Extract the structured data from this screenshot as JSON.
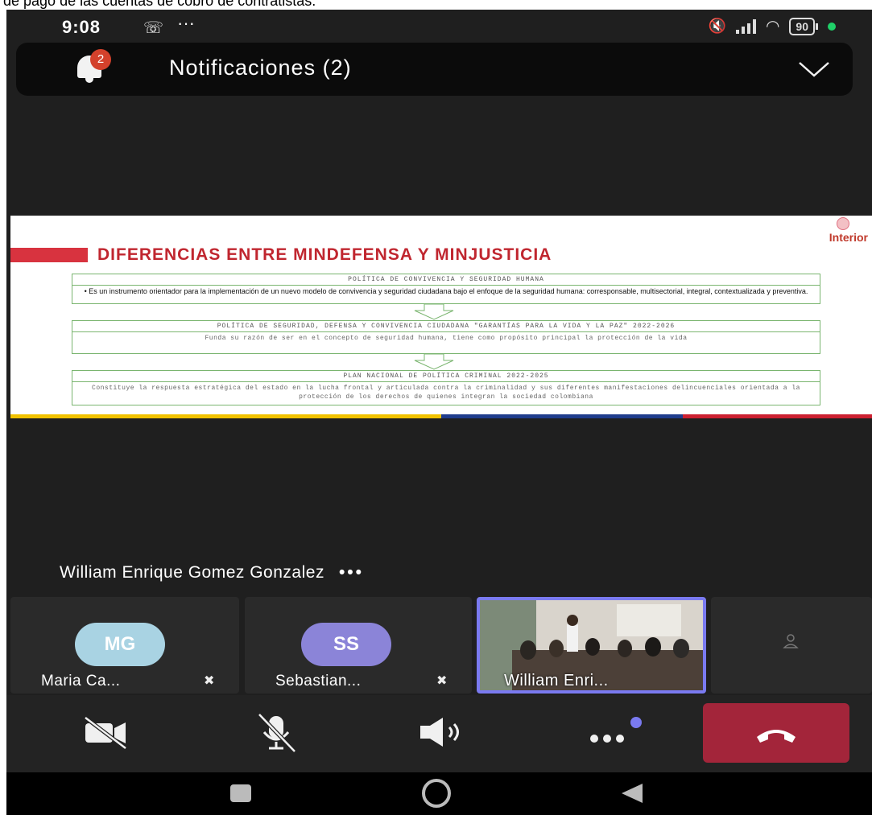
{
  "caption": "de pago de las cuentas de cobro de contratistas.",
  "status_bar": {
    "time": "9:08",
    "battery": "90"
  },
  "notifications": {
    "title": "Notificaciones (2)",
    "badge": "2"
  },
  "slide": {
    "brand": "Interior",
    "heading": "DIFERENCIAS ENTRE MINDEFENSA Y MINJUSTICIA",
    "box1_header": "POLÍTICA DE CONVIVENCIA Y SEGURIDAD HUMANA",
    "box1_body": "• Es un instrumento orientador para la implementación de un nuevo modelo de convivencia y seguridad ciudadana bajo el enfoque de la seguridad humana: corresponsable, multisectorial, integral, contextualizada y preventiva.",
    "box2_header": "POLÍTICA DE SEGURIDAD, DEFENSA Y CONVIVENCIA CIUDADANA \"GARANTÍAS PARA LA VIDA Y LA PAZ\" 2022-2026",
    "box2_body": "Funda su razón de ser en el concepto de seguridad humana, tiene como propósito principal la protección de la vida",
    "box3_header": "PLAN NACIONAL DE POLÍTICA CRIMINAL 2022-2025",
    "box3_body": "Constituye la respuesta estratégica del estado en la lucha frontal y articulada contra la criminalidad y sus diferentes manifestaciones delincuenciales orientada a la protección de los derechos de quienes integran la sociedad colombiana"
  },
  "speaker": {
    "name": "William Enrique Gomez Gonzalez"
  },
  "participants": [
    {
      "initials": "MG",
      "name": "Maria Ca...",
      "color": "#a9d3e3"
    },
    {
      "initials": "SS",
      "name": "Sebastian...",
      "color": "#8b84d8"
    },
    {
      "name": "William Enri..."
    }
  ],
  "colors": {
    "accent": "#7a7af0",
    "hangup": "#a3253a",
    "badge": "#d3412c"
  }
}
